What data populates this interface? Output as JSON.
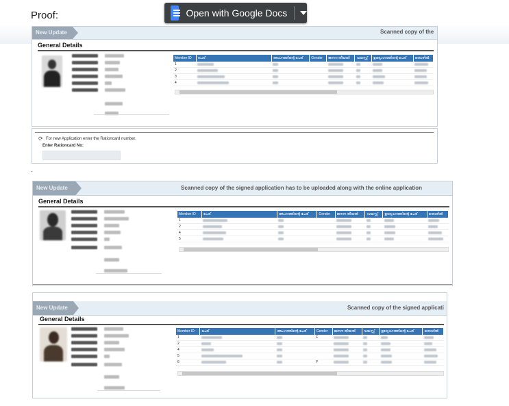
{
  "page": {
    "proof_label": "Proof:"
  },
  "toolbar": {
    "open_with_label": "Open with Google Docs",
    "icon": "google-docs-icon",
    "dropdown_icon": "caret-down-icon"
  },
  "screens": [
    {
      "tag": "New Update",
      "notice": "Scanned copy of the",
      "section_title": "General Details",
      "table_headers": [
        "Member ID",
        "പേര്",
        "അംഗത്തിന്റെ പേര്",
        "Gender",
        "ജനന തീയതി",
        "വയസ്സ്",
        "ഉദ്യോഗത്തിന്റെ പേര്",
        "തൊഴിൽ"
      ],
      "member_ids": [
        "1",
        "2",
        "3",
        "4"
      ],
      "genders": [
        "",
        "",
        "",
        ""
      ]
    },
    {
      "tag": "New Update",
      "notice": "Scanned copy of the signed application has to be uploaded along with the online application",
      "section_title": "General Details",
      "table_headers": [
        "Member ID",
        "പേര്",
        "അംഗത്തിന്റെ പേര്",
        "Gender",
        "ജനന തീയതി",
        "വയസ്സ്",
        "ഉദ്യോഗത്തിന്റെ പേര്",
        "തൊഴിൽ"
      ],
      "member_ids": [
        "1",
        "2",
        "4",
        "5"
      ],
      "genders": [
        "",
        "",
        "",
        ""
      ]
    },
    {
      "tag": "New Update",
      "notice": "Scanned copy of the signed applicati",
      "section_title": "General Details",
      "table_headers": [
        "Member ID",
        "പേര്",
        "അംഗത്തിന്റെ പേര്",
        "Gender",
        "ജനന തീയതി",
        "വയസ്സ്",
        "ഉദ്യോഗത്തിന്റെ പേര്",
        "തൊഴിൽ"
      ],
      "member_ids": [
        "1",
        "2",
        "4",
        "5",
        "6"
      ],
      "genders": [
        "F",
        "",
        "",
        "",
        "F"
      ]
    }
  ],
  "rationcard": {
    "hint": "For new Application enter the Rationcard number.",
    "label": "Enter Rationcard No:",
    "icon": "refresh-icon"
  },
  "separator": "-"
}
